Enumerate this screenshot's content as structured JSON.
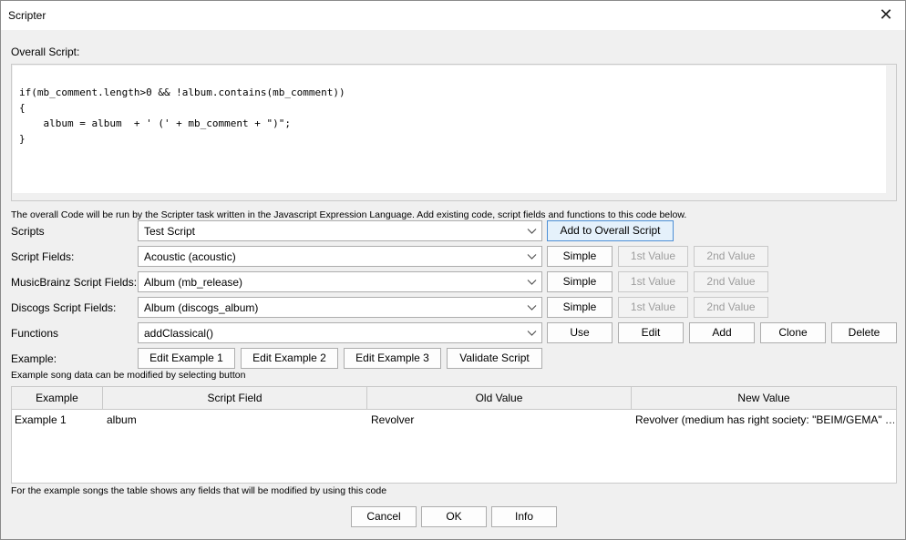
{
  "window": {
    "title": "Scripter",
    "close_glyph": "✕"
  },
  "overall_script": {
    "label": "Overall Script:",
    "code": "if(mb_comment.length>0 && !album.contains(mb_comment))\n{\n    album = album  + ' (' + mb_comment + \")\";\n}",
    "note": "The overall Code will be run by the Scripter task written in the Javascript Expression Language. Add existing code, script fields and functions to this code below."
  },
  "scripts": {
    "label": "Scripts",
    "value": "Test Script",
    "add_button": "Add to Overall Script"
  },
  "script_fields": {
    "label": "Script Fields:",
    "value": "Acoustic (acoustic)",
    "simple": "Simple",
    "first": "1st Value",
    "second": "2nd Value"
  },
  "musicbrainz_fields": {
    "label": "MusicBrainz Script Fields:",
    "value": "Album (mb_release)",
    "simple": "Simple",
    "first": "1st Value",
    "second": "2nd Value"
  },
  "discogs_fields": {
    "label": "Discogs Script Fields:",
    "value": "Album (discogs_album)",
    "simple": "Simple",
    "first": "1st Value",
    "second": "2nd Value"
  },
  "functions": {
    "label": "Functions",
    "value": "addClassical()",
    "use": "Use",
    "edit": "Edit",
    "add": "Add",
    "clone": "Clone",
    "delete": "Delete"
  },
  "example": {
    "label": "Example:",
    "buttons": [
      "Edit Example 1",
      "Edit Example 2",
      "Edit Example 3",
      "Validate Script"
    ],
    "note": "Example song data can be modified by selecting button"
  },
  "table": {
    "headers": [
      "Example",
      "Script Field",
      "Old Value",
      "New Value"
    ],
    "rows": [
      [
        "Example 1",
        "album",
        "Revolver",
        "Revolver (medium has right society: \"BEIM/GEMA\" …"
      ]
    ],
    "note": "For the example songs the table shows any fields that will be modified by using this code"
  },
  "footer": {
    "cancel": "Cancel",
    "ok": "OK",
    "info": "Info"
  },
  "icons": {
    "dropdown": "chevron-down-icon",
    "close": "close-icon"
  },
  "colors": {
    "accent_border": "#4d8fd6",
    "accent_fill": "#e5f1fb",
    "disabled_text": "#9d9d9d"
  }
}
